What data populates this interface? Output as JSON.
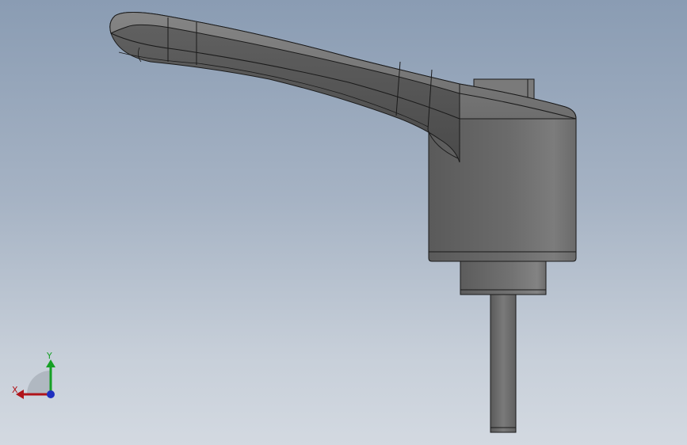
{
  "viewport": {
    "background_top": "#8a9cb3",
    "background_bottom": "#d3d9e1"
  },
  "model": {
    "shade_dark": "#4c4c4c",
    "shade_mid": "#6a6a6a",
    "shade_light": "#8a8a8a",
    "edge_color": "#1a1a1a"
  },
  "triad": {
    "x_label": "X",
    "y_label": "Y",
    "x_color": "#b0141a",
    "y_color": "#16a025",
    "z_color": "#1f2fbf"
  }
}
